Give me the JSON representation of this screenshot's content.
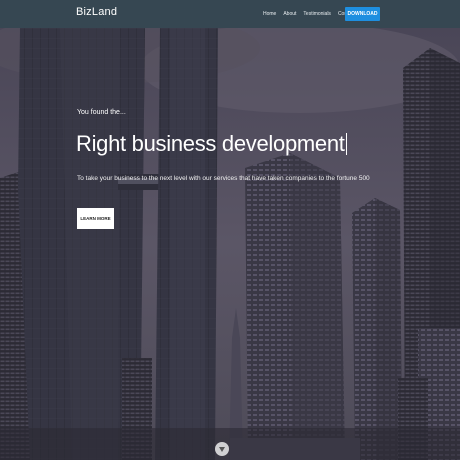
{
  "nav": {
    "brand": "BizLand",
    "links": [
      "Home",
      "About",
      "Testimonials",
      "Contact"
    ],
    "download_label": "DOWNLOAD",
    "accent": "#1e8fe0"
  },
  "hero": {
    "intro": "You found the...",
    "headline": "Right business development",
    "tagline": "To take your business to the next level with our services that have taken companies to the fortune 500",
    "cta_label": "LEARN MORE",
    "scroll_icon": "chevron-down-icon"
  },
  "colors": {
    "navbar": "#364752",
    "overlay": "#3e3a4a"
  }
}
